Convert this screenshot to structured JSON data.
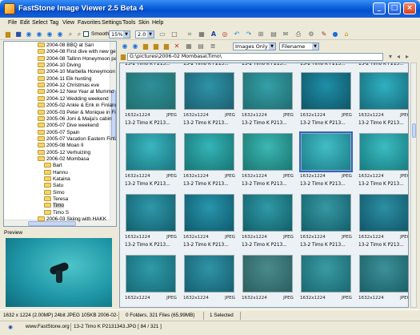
{
  "window": {
    "title": "FastStone Image Viewer 2.5 Beta 4"
  },
  "menu": [
    "File",
    "Edit",
    "Select",
    "Tag",
    "View",
    "Favorites",
    "Settings",
    "Tools",
    "Skin",
    "Help"
  ],
  "toolbar": {
    "smooth_label": "Smooth",
    "zoom_value": "15%",
    "gamma_value": "2.0"
  },
  "tree": {
    "items": [
      {
        "label": "2004-08 BBQ at Sari",
        "indent": 1
      },
      {
        "label": "2004-08 First dive with new ge",
        "indent": 1
      },
      {
        "label": "2004-08 Tallinn Honeymoon pa",
        "indent": 1
      },
      {
        "label": "2004-10 Diving",
        "indent": 1
      },
      {
        "label": "2004-10 Marbella Honeymoon p",
        "indent": 1
      },
      {
        "label": "2004-11 Elk hunting",
        "indent": 1
      },
      {
        "label": "2004-12 Christmas eve",
        "indent": 1
      },
      {
        "label": "2004-12 New Year at Mummo",
        "indent": 1
      },
      {
        "label": "2004-12 Wedding weekend",
        "indent": 1
      },
      {
        "label": "2005-02 Ankie & Erik in Finland",
        "indent": 1
      },
      {
        "label": "2005-03 Peter & Monique in Fir",
        "indent": 1
      },
      {
        "label": "2005-06 Joni & Maija's cabin",
        "indent": 1
      },
      {
        "label": "2005-07 Dive weekend",
        "indent": 1
      },
      {
        "label": "2005-07 Spain",
        "indent": 1
      },
      {
        "label": "2005-07 Vacation Eastern Finla",
        "indent": 1
      },
      {
        "label": "2005-08 Moan II",
        "indent": 1
      },
      {
        "label": "2005-12 Verhuizing",
        "indent": 1
      },
      {
        "label": "2006-02 Mombasa",
        "indent": 1
      },
      {
        "label": "Bart",
        "indent": 2
      },
      {
        "label": "Hannu",
        "indent": 2
      },
      {
        "label": "Kataina",
        "indent": 2
      },
      {
        "label": "Satu",
        "indent": 2
      },
      {
        "label": "Simo",
        "indent": 2
      },
      {
        "label": "Teresa",
        "indent": 2
      },
      {
        "label": "Timo",
        "indent": 2,
        "selected": true
      },
      {
        "label": "Timo S",
        "indent": 2
      },
      {
        "label": "2006-03 Skiing with HAKK",
        "indent": 1
      }
    ]
  },
  "preview": {
    "label": "Preview",
    "info": "1632 x 1224 (2.00MP)  24bit JPEG  105KB  2006-02-"
  },
  "browser": {
    "path": "G:\\pictures\\2006-02 Mombasa\\Timo\\",
    "filter": "Images Only",
    "sort": "Filename",
    "top_row_names": [
      "13-2 Timo K P213...",
      "13-2 Timo K P213...",
      "13-2 Timo K P213...",
      "13-2 Timo K P213...",
      "13-2 Timo K P213..."
    ],
    "rows": [
      {
        "cells": [
          {
            "dims": "1632x1224",
            "fmt": "JPEG",
            "name": "13-2 Timo K P213...",
            "c1": "#2f8f9a",
            "c2": "#1f6f6c"
          },
          {
            "dims": "1632x1224",
            "fmt": "JPEG",
            "name": "13-2 Timo K P213...",
            "c1": "#2e93a7",
            "c2": "#1d5f72"
          },
          {
            "dims": "1632x1224",
            "fmt": "JPEG",
            "name": "13-2 Timo K P213...",
            "c1": "#34a0a8",
            "c2": "#206c70"
          },
          {
            "dims": "1632x1224",
            "fmt": "JPEG",
            "name": "13-2 Timo K P213...",
            "c1": "#1e8fa8",
            "c2": "#0f5566"
          },
          {
            "dims": "1632x1224",
            "fmt": "JPEG",
            "name": "13-2 Timo K P213...",
            "c1": "#2fb0c0",
            "c2": "#176a7a"
          }
        ]
      },
      {
        "cells": [
          {
            "dims": "1632x1224",
            "fmt": "JPEG",
            "name": "13-2 Timo K P213...",
            "c1": "#3ab6bf",
            "c2": "#1a7480"
          },
          {
            "dims": "1632x1224",
            "fmt": "JPEG",
            "name": "13-2 Timo K P213...",
            "c1": "#35b4b7",
            "c2": "#177574"
          },
          {
            "dims": "1632x1224",
            "fmt": "JPEG",
            "name": "13-2 Timo K P213...",
            "c1": "#3cb7b2",
            "c2": "#1a7772"
          },
          {
            "dims": "1632x1224",
            "fmt": "JPEG",
            "name": "13-2 Timo K P213...",
            "c1": "#43bdc5",
            "c2": "#1b7d88",
            "selected": true
          },
          {
            "dims": "1632x1224",
            "fmt": "JPEG",
            "name": "13-2 Timo K P213...",
            "c1": "#3bbcc1",
            "c2": "#177b80"
          }
        ]
      },
      {
        "cells": [
          {
            "dims": "1632x1224",
            "fmt": "JPEG",
            "name": "13-2 Timo K P213...",
            "c1": "#2f98a9",
            "c2": "#135f6e"
          },
          {
            "dims": "1632x1224",
            "fmt": "JPEG",
            "name": "13-2 Timo K P213...",
            "c1": "#2896ab",
            "c2": "#0f5a6f"
          },
          {
            "dims": "1632x1224",
            "fmt": "JPEG",
            "name": "13-2 Timo K P213...",
            "c1": "#2f9aa6",
            "c2": "#125f69"
          },
          {
            "dims": "1632x1224",
            "fmt": "JPEG",
            "name": "13-2 Timo K P213...",
            "c1": "#3698a3",
            "c2": "#13606b"
          },
          {
            "dims": "1632x1224",
            "fmt": "JPEG",
            "name": "13-2 Timo K P213...",
            "c1": "#2d8fa3",
            "c2": "#10566a"
          }
        ]
      },
      {
        "cells": [
          {
            "dims": "1632x1224",
            "fmt": "JPEG",
            "name": "",
            "c1": "#2f9aa8",
            "c2": "#166a77"
          },
          {
            "dims": "1632x1224",
            "fmt": "JPEG",
            "name": "",
            "c1": "#2f94a5",
            "c2": "#155f71"
          },
          {
            "dims": "1632x1224",
            "fmt": "JPEG",
            "name": "",
            "c1": "#4a8a8c",
            "c2": "#2b5f60"
          },
          {
            "dims": "1632x1224",
            "fmt": "JPEG",
            "name": "",
            "c1": "#3a9aa4",
            "c2": "#1a6870"
          },
          {
            "dims": "1632x1224",
            "fmt": "JPEG",
            "name": "",
            "c1": "#3c9099",
            "c2": "#1b5f66"
          }
        ]
      }
    ]
  },
  "status": {
    "folders": "0 Folders, 321 Files (65,99MB)",
    "selected": "1 Selected",
    "website": "www.FastStone.org",
    "file": "13-2 Timo K P2131343.JPG [ 84 / 321 ]"
  },
  "colors": {
    "title_bar": "#0a5fd8",
    "selection": "#3166c7",
    "folder": "#f4d46a"
  }
}
